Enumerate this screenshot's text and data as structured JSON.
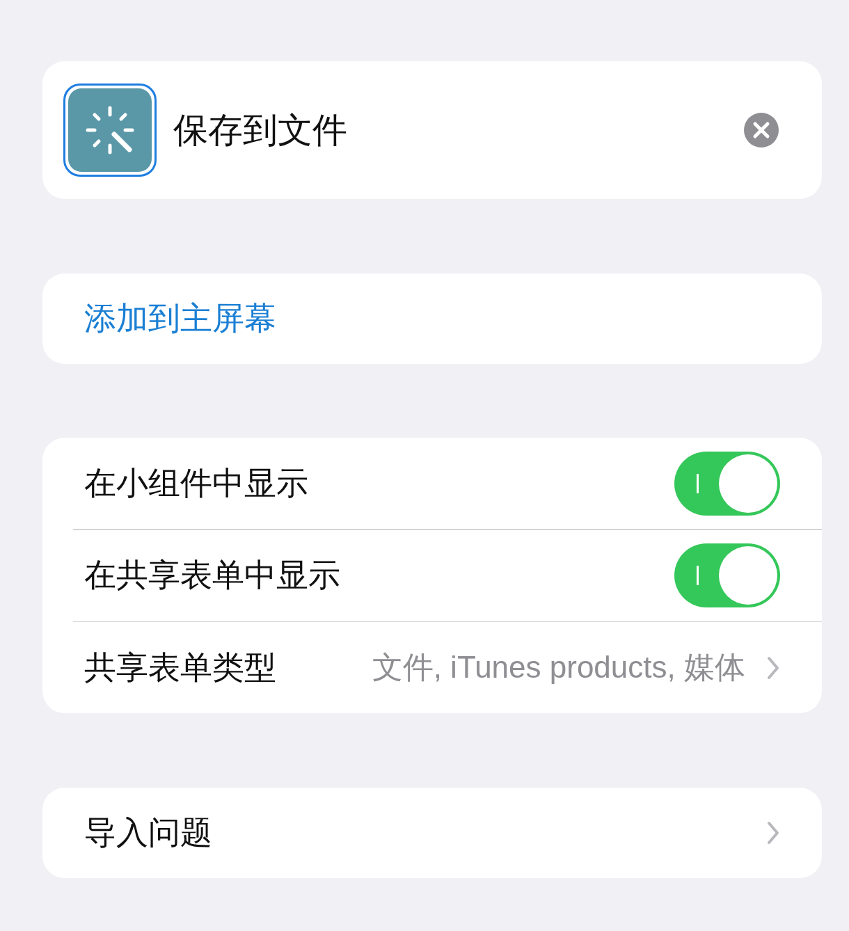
{
  "header": {
    "title": "保存到文件",
    "icon_selected": true
  },
  "add_to_home": {
    "label": "添加到主屏幕"
  },
  "settings": [
    {
      "kind": "toggle",
      "label": "在小组件中显示",
      "on": true
    },
    {
      "kind": "toggle",
      "label": "在共享表单中显示",
      "on": true
    },
    {
      "kind": "link",
      "label": "共享表单类型",
      "value": "文件, iTunes products, 媒体"
    }
  ],
  "import": {
    "label": "导入问题"
  }
}
